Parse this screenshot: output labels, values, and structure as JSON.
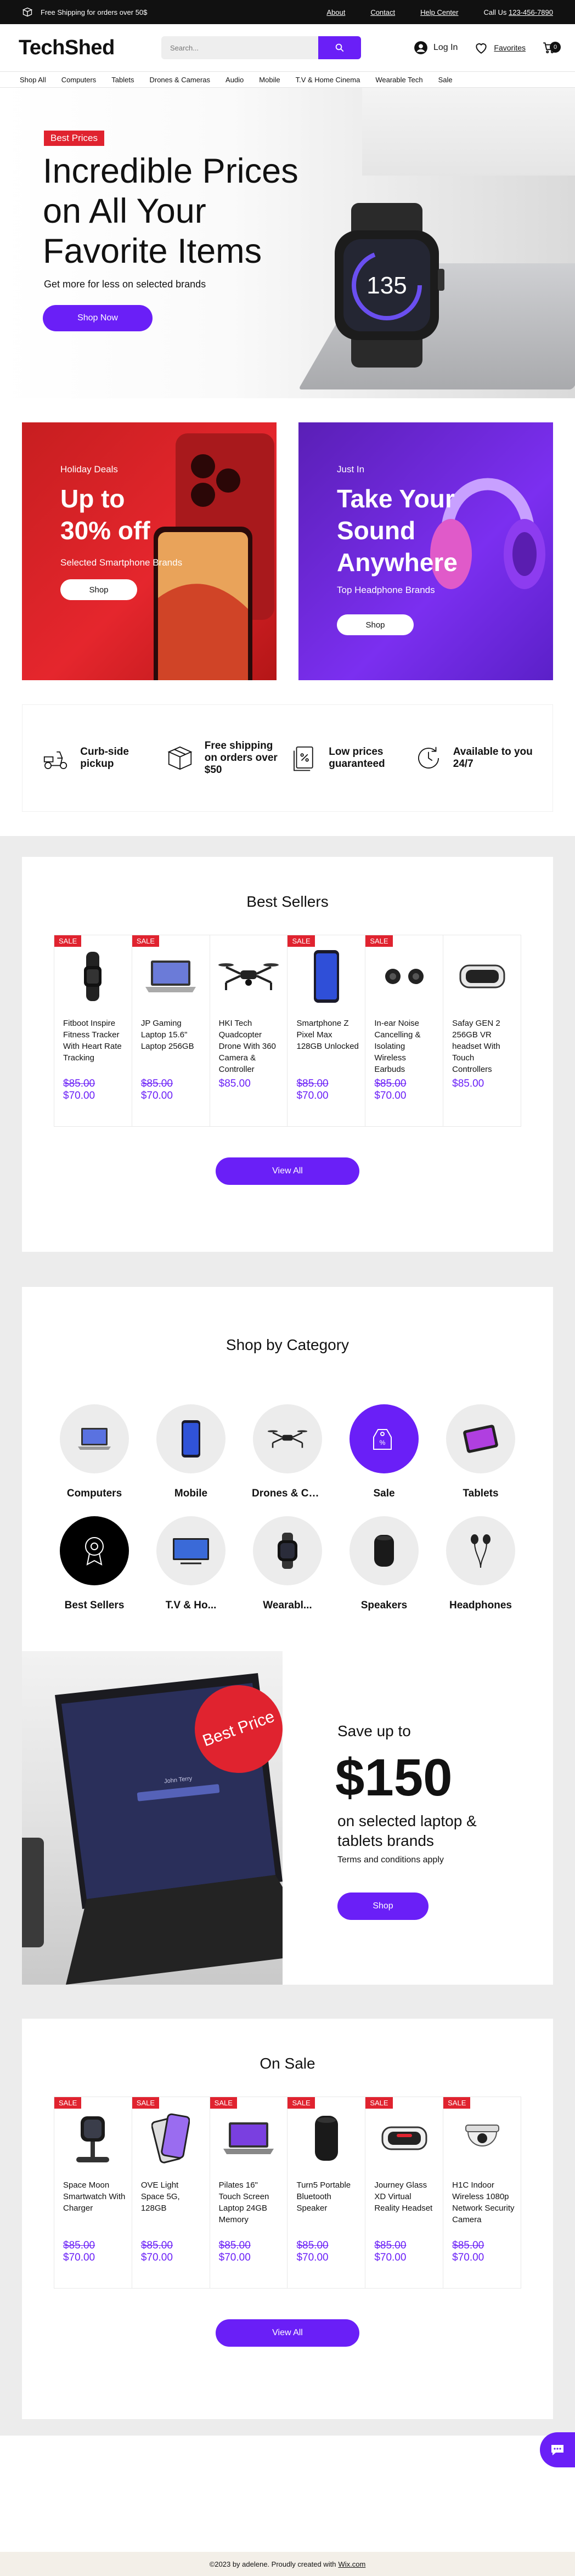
{
  "topbar": {
    "shipping": "Free Shipping for orders over 50$",
    "about": "About",
    "contact": "Contact",
    "help": "Help Center",
    "call_prefix": "Call Us",
    "phone": "123-456-7890"
  },
  "header": {
    "logo": "TechShed",
    "search_placeholder": "Search...",
    "login": "Log In",
    "favorites": "Favorites",
    "cart_count": "0"
  },
  "nav": [
    "Shop All",
    "Computers",
    "Tablets",
    "Drones & Cameras",
    "Audio",
    "Mobile",
    "T.V & Home Cinema",
    "Wearable Tech",
    "Sale"
  ],
  "hero": {
    "badge": "Best Prices",
    "title": "Incredible Prices on All Your Favorite Items",
    "subtitle": "Get more for less on selected brands",
    "cta": "Shop Now",
    "watch_time": "135"
  },
  "promos": [
    {
      "kicker": "Holiday Deals",
      "title_line1": "Up to",
      "title_line2": "30% off",
      "subtitle": "Selected Smartphone Brands",
      "cta": "Shop"
    },
    {
      "kicker": "Just In",
      "title_line1": "Take Your",
      "title_line2": "Sound",
      "title_line3": "Anywhere",
      "subtitle": "Top Headphone Brands",
      "cta": "Shop"
    }
  ],
  "features": [
    {
      "label": "Curb-side pickup",
      "icon": "scooter-icon"
    },
    {
      "label": "Free shipping on orders over $50",
      "icon": "box-icon"
    },
    {
      "label": "Low prices guaranteed",
      "icon": "price-tag-icon"
    },
    {
      "label": "Available to you 24/7",
      "icon": "clock-icon"
    }
  ],
  "best_sellers": {
    "title": "Best Sellers",
    "view_all": "View All",
    "items": [
      {
        "sale": "SALE",
        "name": "Fitboot Inspire Fitness Tracker With Heart Rate Tracking",
        "old_price": "$85.00",
        "price": "$70.00",
        "icon": "fitness-tracker-icon"
      },
      {
        "sale": "SALE",
        "name": "JP Gaming Laptop 15.6\" Laptop 256GB",
        "old_price": "$85.00",
        "price": "$70.00",
        "icon": "laptop-icon"
      },
      {
        "sale": "",
        "name": "HKI Tech Quadcopter Drone With 360 Camera & Controller",
        "old_price": "",
        "price": "$85.00",
        "icon": "drone-icon"
      },
      {
        "sale": "SALE",
        "name": "Smartphone Z Pixel Max 128GB Unlocked",
        "old_price": "$85.00",
        "price": "$70.00",
        "icon": "smartphone-icon"
      },
      {
        "sale": "SALE",
        "name": "In-ear Noise Cancelling & Isolating Wireless Earbuds",
        "old_price": "$85.00",
        "price": "$70.00",
        "icon": "earbuds-icon"
      },
      {
        "sale": "",
        "name": "Safay GEN 2 256GB VR headset With Touch Controllers",
        "old_price": "",
        "price": "$85.00",
        "icon": "vr-headset-icon"
      }
    ]
  },
  "categories": {
    "title": "Shop by Category",
    "items": [
      "Computers",
      "Mobile",
      "Drones & Cameras",
      "Sale",
      "Tablets",
      "Best Sellers",
      "T.V & Ho...",
      "Wearabl...",
      "Speakers",
      "Headphones"
    ]
  },
  "banner": {
    "badge": "Best Price",
    "line1": "Save up to",
    "amount": "$150",
    "line2": "on selected laptop & tablets brands",
    "terms": "Terms and conditions apply",
    "cta": "Shop",
    "screen_name": "John Terry"
  },
  "on_sale": {
    "title": "On Sale",
    "view_all": "View All",
    "items": [
      {
        "sale": "SALE",
        "name": "Space Moon Smartwatch With Charger",
        "old_price": "$85.00",
        "price": "$70.00",
        "icon": "watch-charger-icon"
      },
      {
        "sale": "SALE",
        "name": "OVE Light Space 5G, 128GB",
        "old_price": "$85.00",
        "price": "$70.00",
        "icon": "phone-icon"
      },
      {
        "sale": "SALE",
        "name": "Pilates 16\" Touch Screen Laptop 24GB Memory",
        "old_price": "$85.00",
        "price": "$70.00",
        "icon": "laptop-icon"
      },
      {
        "sale": "SALE",
        "name": "Turn5 Portable Bluetooth Speaker",
        "old_price": "$85.00",
        "price": "$70.00",
        "icon": "speaker-icon"
      },
      {
        "sale": "SALE",
        "name": "Journey Glass XD Virtual Reality Headset",
        "old_price": "$85.00",
        "price": "$70.00",
        "icon": "vr-headset-icon"
      },
      {
        "sale": "SALE",
        "name": "H1C Indoor Wireless 1080p Network Security Camera",
        "old_price": "$85.00",
        "price": "$70.00",
        "icon": "security-camera-icon"
      }
    ]
  },
  "footer": {
    "text": "©2023 by adelene. Proudly created with",
    "link": "Wix.com"
  },
  "colors": {
    "accent": "#6a1ff7",
    "sale": "#e0232f",
    "promo_red": "#e5262d",
    "promo_purple": "#7b2ff0"
  }
}
